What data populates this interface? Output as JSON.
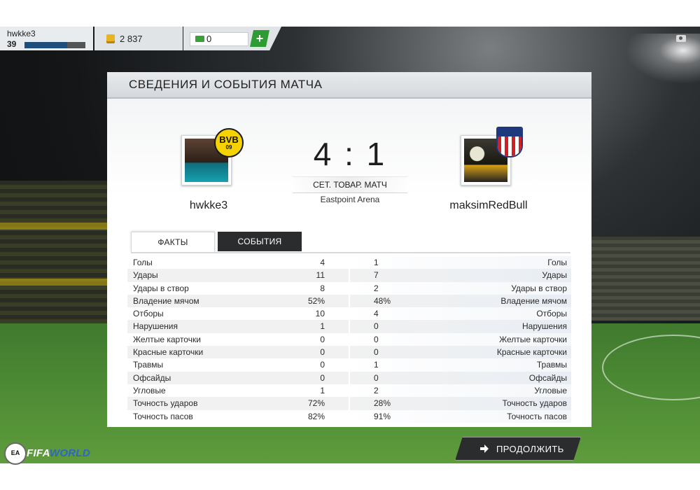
{
  "topbar": {
    "username": "hwkke3",
    "level": "39",
    "xp_progress": 0.7,
    "coins": "2 837",
    "points": "0",
    "add_label": "+"
  },
  "panel": {
    "title": "СВЕДЕНИЯ И СОБЫТИЯ МАТЧА"
  },
  "match": {
    "home": {
      "name": "hwkke3",
      "badge_text": "BVB",
      "badge_sub": "09"
    },
    "away": {
      "name": "maksimRedBull"
    },
    "score": "4 : 1",
    "type": "СЕТ. ТОВАР. МАТЧ",
    "venue": "Eastpoint Arena"
  },
  "tabs": [
    {
      "label": "ФАКТЫ",
      "active": true
    },
    {
      "label": "СОБЫТИЯ",
      "active": false
    }
  ],
  "stats": [
    {
      "label": "Голы",
      "home": "4",
      "away": "1"
    },
    {
      "label": "Удары",
      "home": "11",
      "away": "7"
    },
    {
      "label": "Удары в створ",
      "home": "8",
      "away": "2"
    },
    {
      "label": "Владение мячом",
      "home": "52%",
      "away": "48%"
    },
    {
      "label": "Отборы",
      "home": "10",
      "away": "4"
    },
    {
      "label": "Нарушения",
      "home": "1",
      "away": "0"
    },
    {
      "label": "Желтые карточки",
      "home": "0",
      "away": "0"
    },
    {
      "label": "Красные карточки",
      "home": "0",
      "away": "0"
    },
    {
      "label": "Травмы",
      "home": "0",
      "away": "1"
    },
    {
      "label": "Офсайды",
      "home": "0",
      "away": "0"
    },
    {
      "label": "Угловые",
      "home": "1",
      "away": "2"
    },
    {
      "label": "Точность ударов",
      "home": "72%",
      "away": "28%"
    },
    {
      "label": "Точность пасов",
      "home": "82%",
      "away": "91%"
    }
  ],
  "footer": {
    "logo_ea": "EA",
    "logo_fifa": "FIFA",
    "logo_world": "WORLD",
    "continue_label": "ПРОДОЛЖИТЬ"
  },
  "colors": {
    "accent_green": "#2f9b35",
    "xp_blue": "#1e4f7c",
    "dark_tab": "#2b2c2e"
  }
}
